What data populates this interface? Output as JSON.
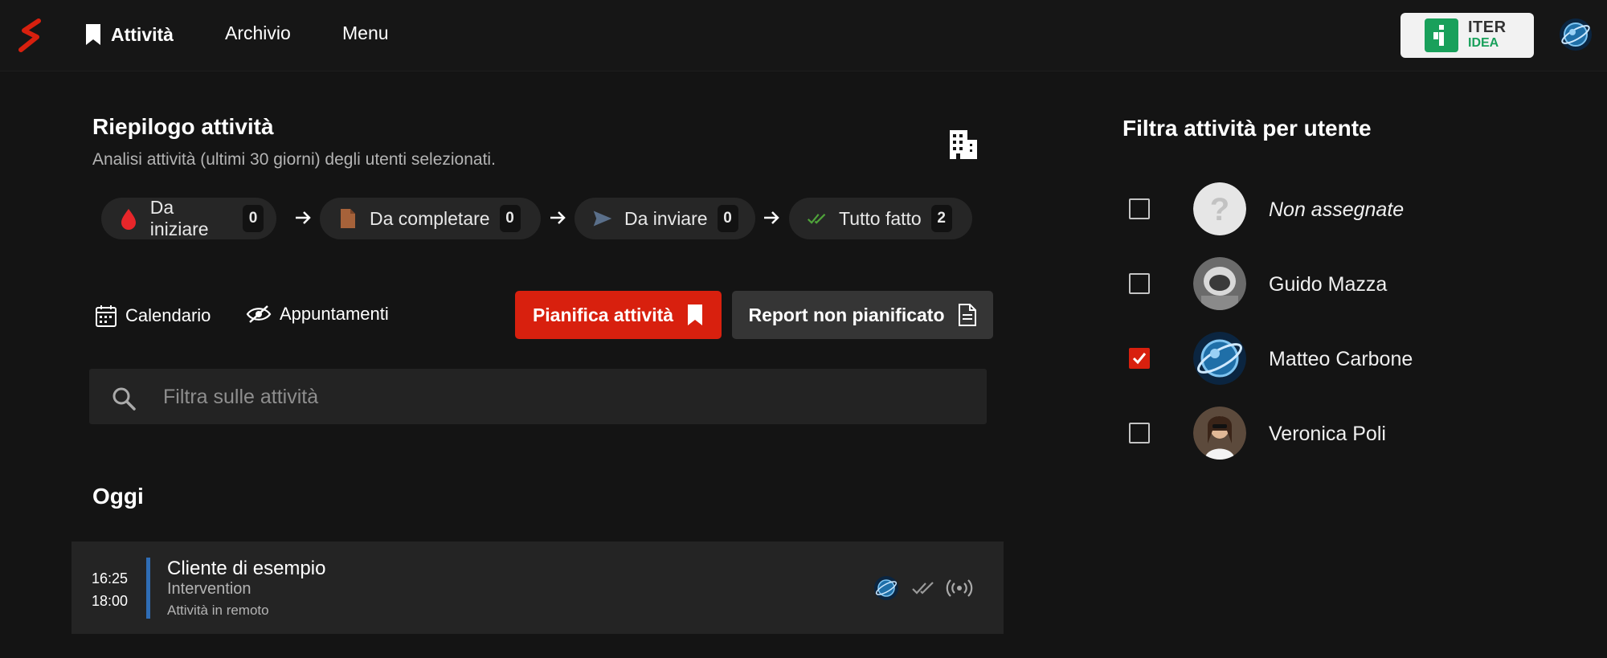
{
  "nav": {
    "items": [
      {
        "label": "Attività",
        "active": true,
        "icon": "bookmark-icon"
      },
      {
        "label": "Archivio",
        "active": false
      },
      {
        "label": "Menu",
        "active": false
      }
    ],
    "brand_line1": "ITER",
    "brand_line2": "IDEA"
  },
  "summary": {
    "title": "Riepilogo attività",
    "subtitle": "Analisi attività (ultimi 30 giorni) degli utenti selezionati.",
    "stages": [
      {
        "label": "Da iniziare",
        "count": "0",
        "icon": "drop-icon",
        "color": "#e8262a"
      },
      {
        "label": "Da completare",
        "count": "0",
        "icon": "document-icon",
        "color": "#a6623a"
      },
      {
        "label": "Da inviare",
        "count": "0",
        "icon": "send-icon",
        "color": "#5a6f8a"
      },
      {
        "label": "Tutto fatto",
        "count": "2",
        "icon": "double-check-icon",
        "color": "#4fa33a"
      }
    ]
  },
  "toolbar": {
    "calendar_label": "Calendario",
    "appointments_label": "Appuntamenti",
    "plan_label": "Pianifica attività",
    "report_label": "Report non pianificato"
  },
  "search": {
    "placeholder": "Filtra sulle attività",
    "value": ""
  },
  "today": {
    "heading": "Oggi",
    "activities": [
      {
        "start": "16:25",
        "end": "18:00",
        "client": "Cliente di esempio",
        "type": "Intervention",
        "note": "Attività in remoto"
      }
    ]
  },
  "filter": {
    "title": "Filtra attività per utente",
    "users": [
      {
        "name": "Non assegnate",
        "checked": false,
        "avatar": "question-avatar"
      },
      {
        "name": "Guido Mazza",
        "checked": false,
        "avatar": "photo-avatar"
      },
      {
        "name": "Matteo Carbone",
        "checked": true,
        "avatar": "globe-avatar"
      },
      {
        "name": "Veronica Poli",
        "checked": false,
        "avatar": "photo-avatar"
      }
    ]
  },
  "colors": {
    "accent": "#d8200e",
    "background": "#141414",
    "brand_green": "#19a05b",
    "activity_bar": "#2f6db5"
  }
}
